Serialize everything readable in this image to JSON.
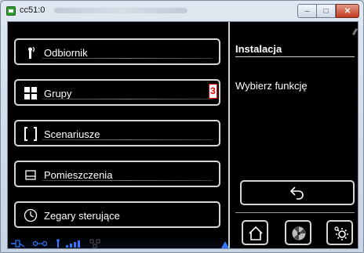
{
  "window": {
    "title": "cc51:0",
    "buttons": [
      "minimize",
      "maximize",
      "close"
    ],
    "close_glyph": "✕",
    "min_glyph": "–",
    "max_glyph": "□"
  },
  "menu": {
    "items": [
      {
        "label": "Odbiornik",
        "icon": "receiver-icon"
      },
      {
        "label": "Grupy",
        "icon": "grid-icon",
        "badge": "3"
      },
      {
        "label": "Scenariusze",
        "icon": "brackets-icon"
      },
      {
        "label": "Pomieszczenia",
        "icon": "room-icon"
      },
      {
        "label": "Zegary sterujące",
        "icon": "clock-icon"
      }
    ]
  },
  "side": {
    "title": "Instalacja",
    "text": "Wybierz funkcję"
  },
  "toolbar": {
    "back_icon": "back-arrow-icon",
    "home_icon": "home-icon",
    "fan_icon": "fan-icon",
    "settings_icon": "settings-icon"
  },
  "colors": {
    "background": "#000000",
    "border": "#d6d6d6",
    "badge": "#dd0000",
    "status_accent": "#2f78ff"
  }
}
